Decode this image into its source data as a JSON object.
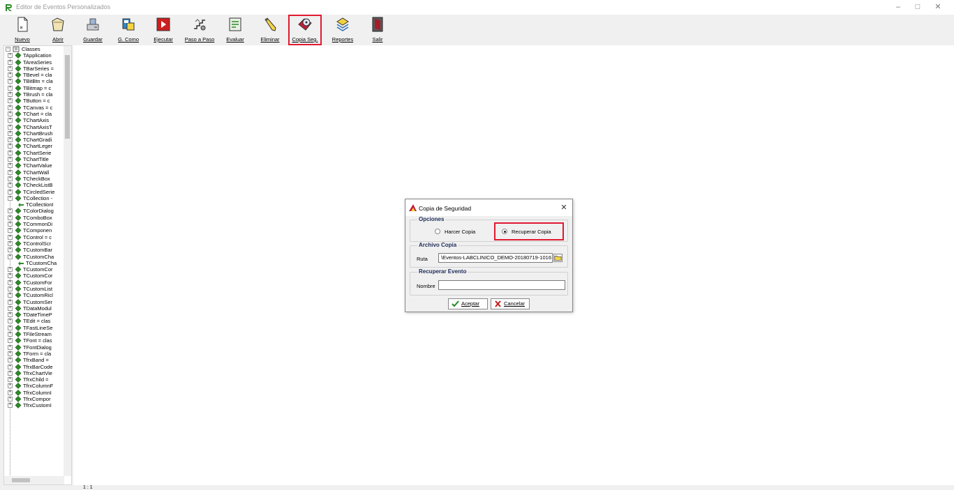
{
  "window": {
    "title": "Editor de Eventos Personalizados",
    "controls": {
      "minimize": "–",
      "maximize": "□",
      "close": "✕"
    }
  },
  "toolbar": {
    "buttons": [
      {
        "label": "Nuevo",
        "icon": "new-document-icon"
      },
      {
        "label": "Abrir",
        "icon": "open-bag-icon"
      },
      {
        "label": "Guardar",
        "icon": "save-drive-icon"
      },
      {
        "label": "G. Como",
        "icon": "save-as-icon"
      },
      {
        "label": "Ejecutar",
        "icon": "execute-play-icon"
      },
      {
        "label": "Paso a Paso",
        "icon": "step-by-step-icon"
      },
      {
        "label": "Evaluar",
        "icon": "evaluate-icon"
      },
      {
        "label": "Eliminar",
        "icon": "delete-pencil-icon"
      },
      {
        "label": "Copia Seg.",
        "icon": "backup-disk-icon",
        "highlighted": true
      },
      {
        "label": "Reportes",
        "icon": "reports-icon"
      },
      {
        "label": "Salir",
        "icon": "exit-door-icon"
      }
    ]
  },
  "tree": {
    "root": "Classes",
    "items": [
      "TApplication",
      "TAreaSeries",
      "TBarSeries =",
      "TBevel = cla",
      "TBitBtn = cla",
      "TBitmap = c",
      "TBrush = cla",
      "TButton = c",
      "TCanvas = c",
      "TChart = cla",
      "TChartAxis",
      "TChartAxisT",
      "TChartBrush",
      "TChartGradi",
      "TChartLeger",
      "TChartSerie",
      "TChartTitle",
      "TChartValue",
      "TChartWall",
      "TCheckBox",
      "TCheckListB",
      "TCircledSerie",
      "TCollection -",
      "TCollectionI",
      "TColorDialog",
      "TComboBox",
      "TCommonDi",
      "TComponen",
      "TControl = c",
      "TControlScr",
      "TCustomBar",
      "TCustomCha",
      "TCustomCha",
      "TCustomCor",
      "TCustomCor",
      "TCustomFor",
      "TCustomList",
      "TCustomRicl",
      "TCustomSer",
      "TDataModul",
      "TDateTimeP",
      "TEdit = clas",
      "TFastLineSe",
      "TFileStream",
      "TFont = clas",
      "TFontDialog",
      "TForm = cla",
      "TfrxBand =",
      "TfrxBarCode",
      "TfrxChartVie",
      "TfrxChild =",
      "TfrxColumnF",
      "TfrxColumnI",
      "TfrxCompor",
      "TfrxCustomI"
    ],
    "leaf_rows": [
      23,
      32
    ]
  },
  "status": {
    "position": "1 : 1"
  },
  "dialog": {
    "title": "Copia de Seguridad",
    "opciones": {
      "legend": "Opciones",
      "option1": "Harcer Copia",
      "option2": "Recuperar Copia",
      "selected": "option2"
    },
    "archivo": {
      "legend": "Archivo Copia",
      "ruta_label": "Ruta",
      "ruta_value": "\\Eventos-LABCLINICO_DEMO-20180719-1016"
    },
    "recuperar": {
      "legend": "Recuperar Evento",
      "nombre_label": "Nombre",
      "nombre_value": ""
    },
    "buttons": {
      "accept": "Aceptar",
      "cancel": "Cancelar"
    }
  },
  "colors": {
    "highlight": "#e0192f",
    "legend_text": "#1c2b57",
    "tree_icon": "#2f8a2a"
  }
}
